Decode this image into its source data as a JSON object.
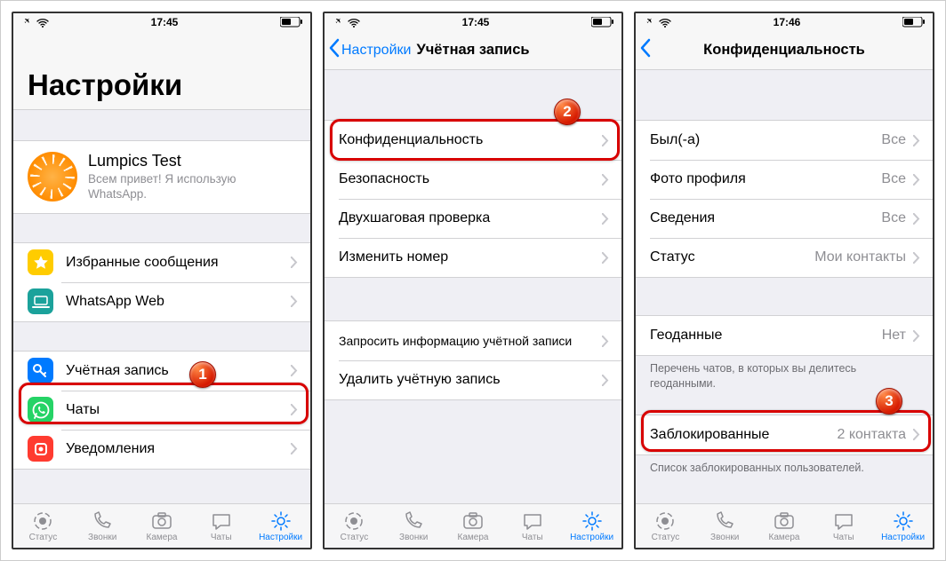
{
  "statusbar": {
    "time1": "17:45",
    "time2": "17:45",
    "time3": "17:46"
  },
  "tabs": {
    "status": "Статус",
    "calls": "Звонки",
    "camera": "Камера",
    "chats": "Чаты",
    "settings": "Настройки"
  },
  "screen1": {
    "large_title": "Настройки",
    "profile_name": "Lumpics Test",
    "profile_status": "Всем привет! Я использую WhatsApp.",
    "row_starred": "Избранные сообщения",
    "row_web": "WhatsApp Web",
    "row_account": "Учётная запись",
    "row_chats": "Чаты",
    "row_notifications": "Уведомления",
    "badge": "1"
  },
  "screen2": {
    "back": "Настройки",
    "title": "Учётная запись",
    "row_privacy": "Конфиденциальность",
    "row_security": "Безопасность",
    "row_2step": "Двухшаговая проверка",
    "row_change_number": "Изменить номер",
    "row_request_info": "Запросить информацию учётной записи",
    "row_delete": "Удалить учётную запись",
    "badge": "2"
  },
  "screen3": {
    "title": "Конфиденциальность",
    "row_lastseen": "Был(-а)",
    "val_lastseen": "Все",
    "row_photo": "Фото профиля",
    "val_photo": "Все",
    "row_about": "Сведения",
    "val_about": "Все",
    "row_status": "Статус",
    "val_status": "Мои контакты",
    "row_live": "Геоданные",
    "val_live": "Нет",
    "footer_live": "Перечень чатов, в которых вы делитесь геоданными.",
    "row_blocked": "Заблокированные",
    "val_blocked": "2 контакта",
    "footer_blocked": "Список заблокированных пользователей.",
    "badge": "3"
  }
}
